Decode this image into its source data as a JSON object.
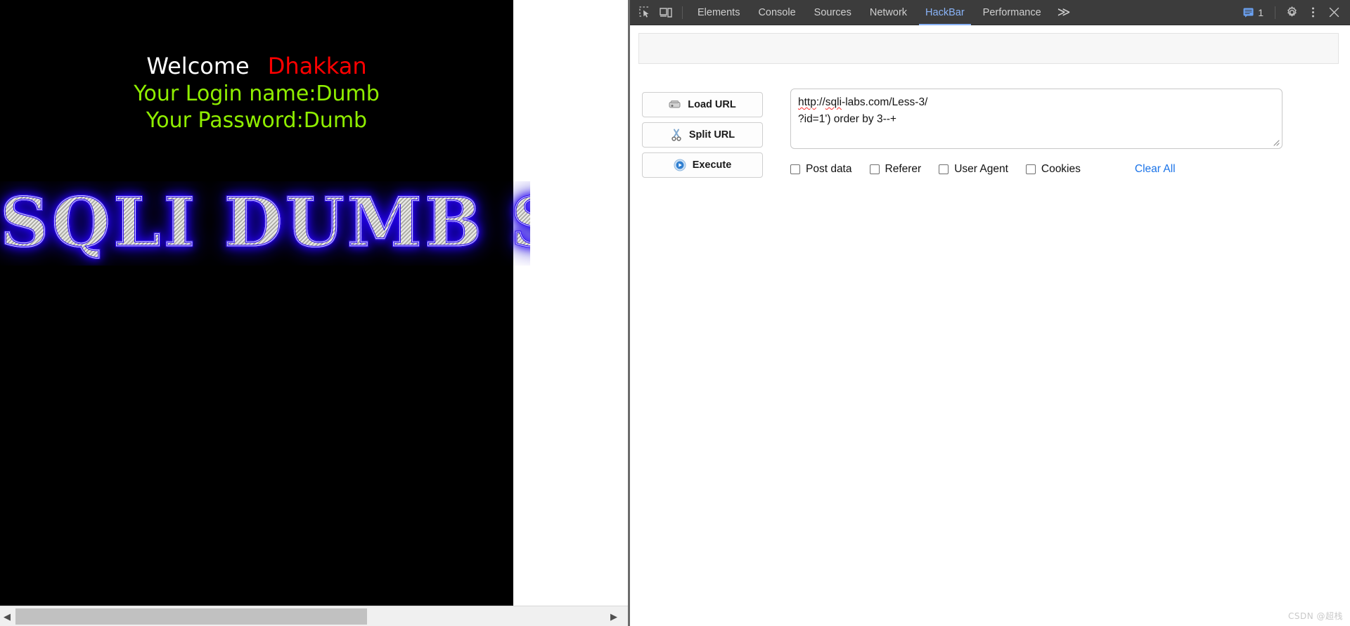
{
  "page": {
    "welcome_prefix": "Welcome",
    "welcome_name": "Dhakkan",
    "login_line": "Your Login name:Dumb",
    "password_line": "Your Password:Dumb",
    "banner_text": "SQLI DUMB S",
    "colors": {
      "background": "#000000",
      "welcome_prefix_color": "#ffffff",
      "welcome_name_color": "#ff0000",
      "credential_color": "#8fee00",
      "banner_glow": "#2200ee",
      "banner_fill": "#c8c8c2"
    },
    "scrollbar": {
      "left_arrow": "◀",
      "right_arrow": "▶"
    }
  },
  "devtools": {
    "toolbar": {
      "inspect_icon": "inspect-element-icon",
      "device_icon": "device-toolbar-icon",
      "overflow_label": "≫",
      "message_count": "1",
      "settings_icon": "gear-icon",
      "more_icon": "kebab-menu-icon",
      "close_icon": "close-icon"
    },
    "tabs": [
      {
        "label": "Elements",
        "active": false
      },
      {
        "label": "Console",
        "active": false
      },
      {
        "label": "Sources",
        "active": false
      },
      {
        "label": "Network",
        "active": false
      },
      {
        "label": "HackBar",
        "active": true
      },
      {
        "label": "Performance",
        "active": false
      }
    ],
    "accent_color": "#8ab4f8"
  },
  "hackbar": {
    "buttons": [
      {
        "label": "Load URL",
        "icon": "load-url-icon"
      },
      {
        "label": "Split URL",
        "icon": "scissors-icon"
      },
      {
        "label": "Execute",
        "icon": "play-icon"
      }
    ],
    "url_field": {
      "line1_spelled": "http",
      "line1_sep": "://",
      "line1_host": "sqli",
      "line1_rest": "-labs.com/Less-3/",
      "line2": "?id=1') order by 3--+",
      "full_value": "http://sqli-labs.com/Less-3/?id=1') order by 3--+",
      "placeholder": ""
    },
    "options": [
      {
        "label": "Post data",
        "checked": false
      },
      {
        "label": "Referer",
        "checked": false
      },
      {
        "label": "User Agent",
        "checked": false
      },
      {
        "label": "Cookies",
        "checked": false
      }
    ],
    "clear_all_label": "Clear All",
    "clear_all_color": "#1a73e8"
  },
  "watermark": {
    "text": "CSDN @超栈"
  }
}
